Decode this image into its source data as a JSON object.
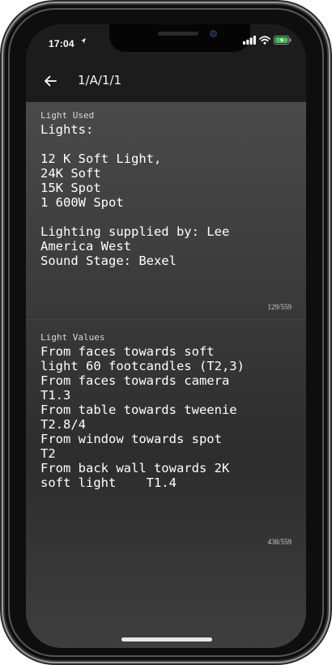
{
  "status_bar": {
    "time": "17:04",
    "icons": [
      "location-icon",
      "signal-icon",
      "wifi-icon",
      "battery-icon"
    ]
  },
  "app_bar": {
    "title": "1/A/1/1",
    "back_icon": "arrow-left-icon"
  },
  "sections": [
    {
      "label": "Light Used",
      "body": "Lights:\n\n12 K Soft Light,\n24K Soft\n15K Spot\n1 600W Spot\n\nLighting supplied by: Lee\nAmerica West\nSound Stage: Bexel",
      "count": "129/559"
    },
    {
      "label": "Light Values",
      "body": "From faces towards soft\nlight 60 footcandles (T2,3)\nFrom faces towards camera\nT1.3\nFrom table towards tweenie\nT2.8/4\nFrom window towards spot\nT2\nFrom back wall towards 2K\nsoft light    T1.4",
      "count": "438/559"
    }
  ],
  "colors": {
    "bar_background": "#1c1c1c",
    "text": "#ffffff",
    "label": "#d8d8d8",
    "battery_fill": "#34c759"
  }
}
